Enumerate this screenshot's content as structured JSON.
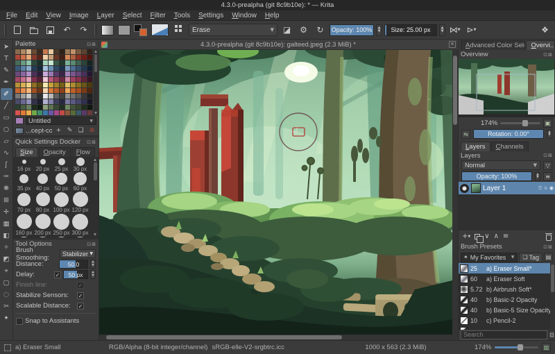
{
  "window": {
    "title": "4.3.0-prealpha (git 8c9b10e): * — Krita"
  },
  "menu": {
    "items": [
      "File",
      "Edit",
      "View",
      "Image",
      "Layer",
      "Select",
      "Filter",
      "Tools",
      "Settings",
      "Window",
      "Help"
    ]
  },
  "toolbar": {
    "brush_mode": "Erase",
    "opacity_label": "Opacity: 100%",
    "size_label": "Size: 25.00 px"
  },
  "toolbox": {
    "tools": [
      {
        "glyph": "➤",
        "name": "shape-select-tool"
      },
      {
        "glyph": "T",
        "name": "text-tool"
      },
      {
        "glyph": "✎",
        "name": "edit-shapes-tool"
      },
      {
        "glyph": "✒",
        "name": "calligraphy-tool"
      },
      {
        "glyph": "✐",
        "name": "freehand-brush-tool",
        "selected": true
      },
      {
        "glyph": "╱",
        "name": "line-tool"
      },
      {
        "glyph": "▭",
        "name": "rectangle-tool"
      },
      {
        "glyph": "○",
        "name": "ellipse-tool"
      },
      {
        "glyph": "▱",
        "name": "polygon-tool"
      },
      {
        "glyph": "∿",
        "name": "polyline-tool"
      },
      {
        "glyph": "ʃ",
        "name": "bezier-curve-tool"
      },
      {
        "glyph": "✑",
        "name": "dynamic-brush-tool"
      },
      {
        "glyph": "❋",
        "name": "multibrush-tool"
      },
      {
        "glyph": "⊞",
        "name": "transform-tool"
      },
      {
        "glyph": "✛",
        "name": "move-tool"
      },
      {
        "glyph": "▦",
        "name": "crop-tool"
      },
      {
        "glyph": "◧",
        "name": "gradient-tool"
      },
      {
        "glyph": "✧",
        "name": "color-sampler-tool"
      },
      {
        "glyph": "◩",
        "name": "fill-tool"
      },
      {
        "glyph": "⌖",
        "name": "assistants-tool"
      },
      {
        "glyph": "▢",
        "name": "rectangular-selection-tool"
      },
      {
        "glyph": "◌",
        "name": "elliptical-selection-tool"
      },
      {
        "glyph": "✂",
        "name": "outline-selection-tool"
      },
      {
        "glyph": "✦",
        "name": "similar-selection-tool"
      }
    ]
  },
  "palette_docker": {
    "title": "Palette",
    "name_value": "Untitled",
    "file_value": "...cept-cookie",
    "colors": [
      [
        "#8a6a4f",
        "#b08a62",
        "#d8b48c",
        "#6a4a34",
        "#3a2a1e",
        "#c87850",
        "#e8c8a0",
        "#4a3828",
        "#2e2218",
        "#9a7a56",
        "#c09068",
        "#7a5a3e",
        "#5a4230",
        "#30241a"
      ],
      [
        "#b04838",
        "#d07048",
        "#e8a878",
        "#8a3828",
        "#5a241a",
        "#f0d0a8",
        "#c8a078",
        "#6a3424",
        "#422016",
        "#d88858",
        "#b06040",
        "#902e20",
        "#701e14",
        "#501410"
      ],
      [
        "#4a6a5a",
        "#6a9a80",
        "#8ec4a8",
        "#2e4a3c",
        "#1a3028",
        "#a8d4bc",
        "#c8e8d4",
        "#3a5a48",
        "#24382c",
        "#7ab096",
        "#5a8a72",
        "#406052",
        "#2a4438",
        "#142420"
      ],
      [
        "#3a5a7a",
        "#5a82a8",
        "#88aacc",
        "#243c54",
        "#16283a",
        "#a8c4e0",
        "#6890b4",
        "#2e4a66",
        "#1a3048",
        "#7a9cc0",
        "#4a6e94",
        "#35506e",
        "#223850",
        "#101f30"
      ],
      [
        "#6a4a7a",
        "#8a66a0",
        "#b090c4",
        "#4a3258",
        "#2e1e3a",
        "#c8a8d8",
        "#9878b0",
        "#563a68",
        "#3a2648",
        "#a284b8",
        "#7a5690",
        "#644678",
        "#48305a",
        "#241634"
      ],
      [
        "#a84868",
        "#c87090",
        "#e0a0b8",
        "#802e4c",
        "#561e34",
        "#f0c8d8",
        "#b85878",
        "#943a58",
        "#6a2840",
        "#d088a4",
        "#a04060",
        "#88304c",
        "#5e2238",
        "#3a1524"
      ],
      [
        "#b89038",
        "#d8b058",
        "#f0d080",
        "#907020",
        "#685014",
        "#f8e8b0",
        "#c8a040",
        "#a08028",
        "#786018",
        "#e0c068",
        "#b08c30",
        "#8a7020",
        "#6a5618",
        "#4a3c10"
      ],
      [
        "#c86830",
        "#e89050",
        "#f8b878",
        "#a04e20",
        "#703616",
        "#f8d8b0",
        "#d87838",
        "#b85a28",
        "#8a421c",
        "#f0a860",
        "#c06028",
        "#a85020",
        "#7a3a16",
        "#50260e"
      ],
      [
        "#787878",
        "#a0a0a0",
        "#c8c8c8",
        "#505050",
        "#303030",
        "#e8e8e8",
        "#b8b8b8",
        "#606060",
        "#404040",
        "#909090",
        "#707070",
        "#585858",
        "#383838",
        "#202020"
      ],
      [
        "#4a4a6a",
        "#6a6a92",
        "#9090b8",
        "#32324c",
        "#1e1e30",
        "#b0b0d0",
        "#8080a8",
        "#3e3e5c",
        "#282840",
        "#7878a0",
        "#5a5a82",
        "#46466a",
        "#303050",
        "#181828"
      ],
      [
        "#2e3e2e",
        "#4a5e44",
        "#6a8060",
        "#1e2c1e",
        "#121c12",
        "#8aa07c",
        "#5c7252",
        "#384a34",
        "#243024",
        "#708862",
        "#42543c",
        "#36452f",
        "#202c1c",
        "#101810"
      ],
      [
        "#d9534f",
        "#e07b39",
        "#e8b04a",
        "#70a84a",
        "#3e8e6a",
        "#3c78a8",
        "#6858a8",
        "#a8488a",
        "#c44a4a",
        "#8a5a3a",
        "#586a3a",
        "#3a5a6a",
        "#5a3a6a",
        "#6a3a3a"
      ]
    ]
  },
  "quick_settings": {
    "title": "Quick Settings Docker",
    "tabs": [
      "Size",
      "Opacity",
      "Flow"
    ],
    "active_tab": "Size",
    "sizes": [
      "16 px",
      "20 px",
      "25 px",
      "30 px",
      "35 px",
      "40 px",
      "50 px",
      "60 px",
      "70 px",
      "80 px",
      "100 px",
      "120 px",
      "160 px",
      "200 px",
      "250 px",
      "300 px"
    ],
    "diameters": [
      6,
      8,
      10,
      12,
      13,
      15,
      17,
      19,
      19,
      20,
      21,
      22,
      22,
      22,
      23,
      23
    ]
  },
  "tool_options": {
    "title": "Tool Options",
    "brush_smoothing_label": "Brush Smoothing:",
    "brush_smoothing_value": "Stabilizer",
    "distance_label": "Distance:",
    "distance_value": "50.0",
    "delay_label": "Delay:",
    "delay_value": "50 px",
    "finish_line_label": "Finish line:",
    "stabilize_sensors_label": "Stabilize Sensors:",
    "scalable_distance_label": "Scalable Distance:",
    "snap_label": "Snap to Assistants"
  },
  "canvas": {
    "title": "4.3.0-prealpha (git 8c9b10e): galteed.jpeg (2.3 MiB) *"
  },
  "right_panel": {
    "tabs": {
      "color_selector": "Advanced Color Selec...",
      "overview": "Overvi..."
    },
    "overview": {
      "title": "Overview",
      "zoom": "174%",
      "rotation_label": "Rotation: 0.00°"
    },
    "layers": {
      "tab_layers": "Layers",
      "tab_channels": "Channels",
      "title": "Layers",
      "blend_mode": "Normal",
      "opacity_label": "Opacity:  100%",
      "layer_name": "Layer 1"
    },
    "brush_presets": {
      "title": "Brush Presets",
      "favorites_value": "My Favorites",
      "tag_label": "Tag",
      "search_placeholder": "Search",
      "items": [
        {
          "size": "25",
          "name": "a) Eraser Small*",
          "thumb": "eraser",
          "selected": true
        },
        {
          "size": "60",
          "name": "a) Eraser Soft",
          "thumb": "eraser"
        },
        {
          "size": "5.72",
          "name": "b) Airbrush Soft*",
          "thumb": "airbrush"
        },
        {
          "size": "40",
          "name": "b) Basic-2 Opacity",
          "thumb": "stroke"
        },
        {
          "size": "40",
          "name": "b) Basic-5 Size Opacity",
          "thumb": "stroke"
        },
        {
          "size": "10",
          "name": "c) Pencil-2",
          "thumb": "pencil"
        }
      ]
    }
  },
  "statusbar": {
    "brush_name": "a) Eraser Small",
    "colorspace": "RGB/Alpha (8-bit integer/channel)",
    "profile": "sRGB-elle-V2-srgbtrc.icc",
    "dimensions": "1000 x 563 (2.3 MiB)",
    "zoom": "174%"
  },
  "colors": {
    "accent_blue": "#5d87b0",
    "selection_blue": "#5e86ad",
    "canvas_red_pillar": "#9d4033"
  }
}
